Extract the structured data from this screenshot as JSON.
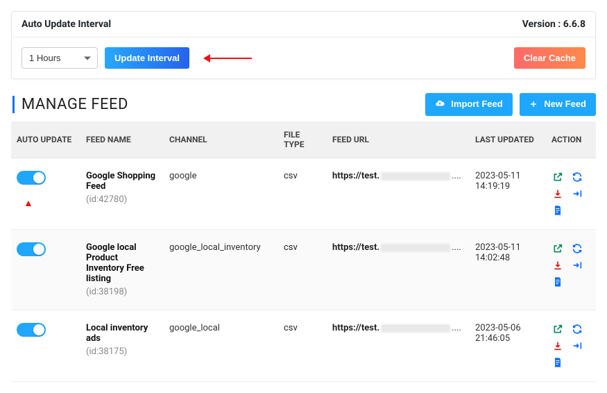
{
  "panel": {
    "title": "Auto Update Interval",
    "version_label": "Version : 6.6.8",
    "interval_value": "1 Hours",
    "update_btn": "Update Interval",
    "clear_cache_btn": "Clear Cache"
  },
  "section": {
    "title": "MANAGE FEED",
    "import_btn": "Import Feed",
    "new_btn": "New Feed"
  },
  "columns": {
    "auto_update": "AUTO UPDATE",
    "feed_name": "FEED NAME",
    "channel": "CHANNEL",
    "file_type": "FILE TYPE",
    "feed_url": "FEED URL",
    "last_updated": "LAST UPDATED",
    "action": "ACTION"
  },
  "rows": [
    {
      "name": "Google Shopping Feed",
      "id_label": "(id:42780)",
      "channel": "google",
      "file_type": "csv",
      "url_prefix": "https://test.",
      "url_suffix": "....",
      "last_updated": "2023-05-11 14:19:19",
      "show_red_arrow": true
    },
    {
      "name": "Google local Product Inventory Free listing",
      "id_label": "(id:38198)",
      "channel": "google_local_inventory",
      "file_type": "csv",
      "url_prefix": "https://test.",
      "url_suffix": "....",
      "last_updated": "2023-05-11 14:02:48",
      "show_red_arrow": false
    },
    {
      "name": "Local inventory ads",
      "id_label": "(id:38175)",
      "channel": "google_local",
      "file_type": "csv",
      "url_prefix": "https://test.",
      "url_suffix": "....",
      "last_updated": "2023-05-06 21:46:05",
      "show_red_arrow": false
    }
  ]
}
